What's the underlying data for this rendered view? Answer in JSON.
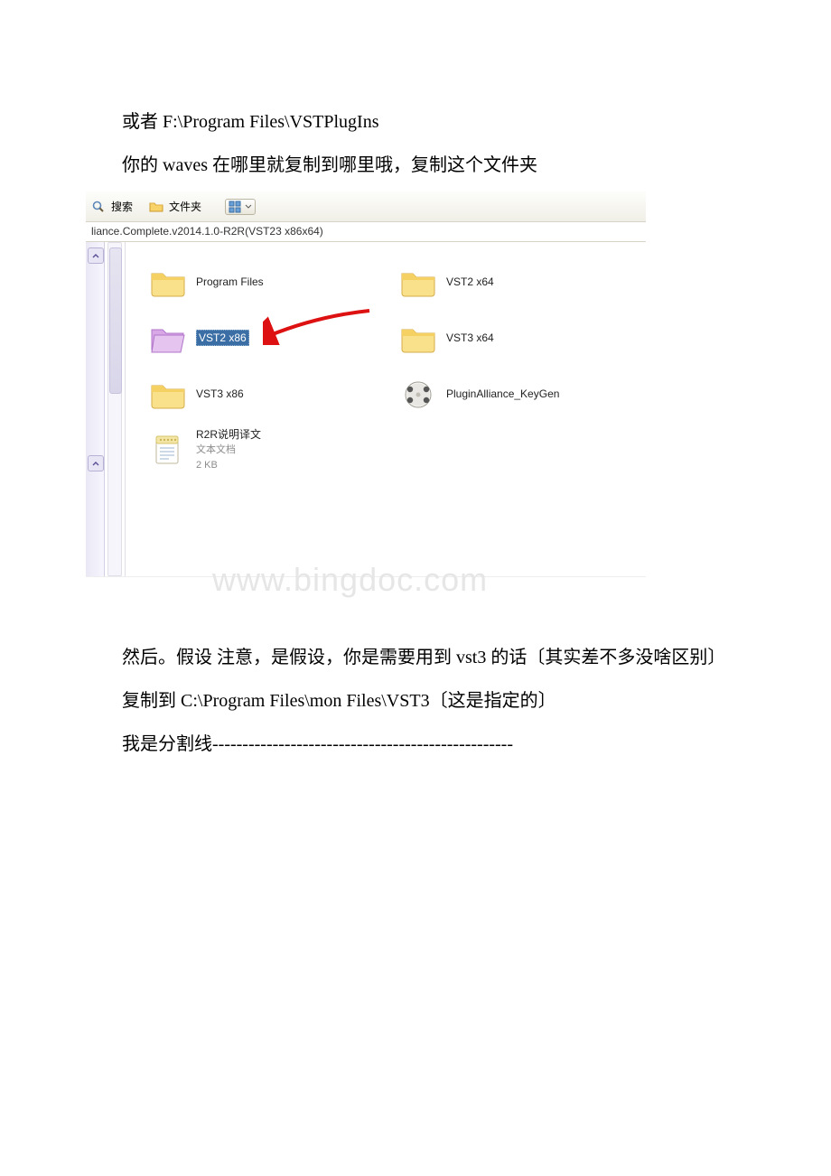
{
  "text": {
    "p1": "或者 F:\\Program Files\\VSTPlugIns",
    "p2": "你的 waves 在哪里就复制到哪里哦，复制这个文件夹",
    "p3": "然后。假设 注意，是假设，你是需要用到 vst3 的话〔其实差不多没啥区别〕",
    "p4": "复制到 C:\\Program Files\\mon Files\\VST3〔这是指定的〕",
    "p5": "我是分割线--------------------------------------------------"
  },
  "toolbar": {
    "search": "搜索",
    "folders": "文件夹"
  },
  "address": "liance.Complete.v2014.1.0-R2R(VST23 x86x64)",
  "items": {
    "program_files": "Program Files",
    "vst2_x64": "VST2 x64",
    "vst2_x86": "VST2 x86",
    "vst3_x64": "VST3 x64",
    "vst3_x86": "VST3 x86",
    "keygen": "PluginAlliance_KeyGen",
    "r2r_name": "R2R说明译文",
    "r2r_type": "文本文档",
    "r2r_size": "2 KB"
  },
  "watermark": "www.bingdoc.com"
}
